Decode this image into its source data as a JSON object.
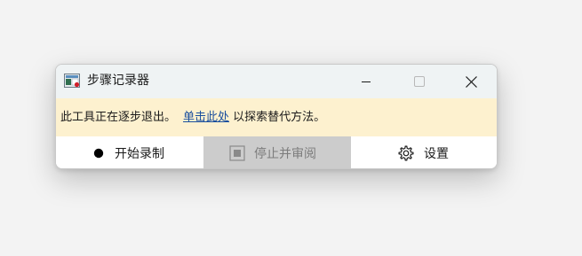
{
  "window": {
    "title": "步骤记录器",
    "app_icon": "steps-recorder-app-icon",
    "controls": {
      "minimize_icon": "minimize-icon",
      "maximize_icon": "maximize-icon",
      "close_icon": "close-icon"
    }
  },
  "infobar": {
    "message": "此工具正在逐步退出。",
    "link_text": "单击此处",
    "suffix": "以探索替代方法。"
  },
  "toolbar": {
    "record_label": "开始录制",
    "record_icon": "record-dot-icon",
    "stop_label": "停止并审阅",
    "stop_icon": "stop-square-icon",
    "settings_label": "设置",
    "settings_icon": "gear-icon"
  },
  "colors": {
    "infobar_bg": "#fdf1cf",
    "titlebar_bg": "#eff3f4",
    "link": "#1a4f9e",
    "disabled_bg": "#cccccc",
    "disabled_text": "#7c7c7c"
  }
}
